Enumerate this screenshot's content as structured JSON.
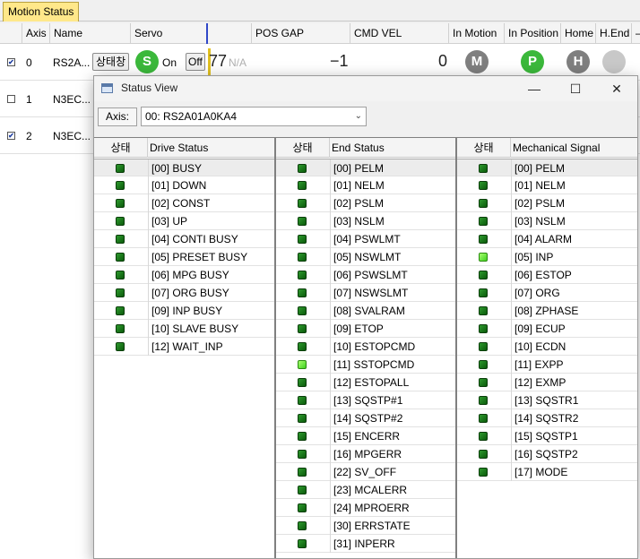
{
  "tab": {
    "label": "Motion Status"
  },
  "grid": {
    "columns": [
      "Axis",
      "Name",
      "Servo",
      "",
      "POS GAP",
      "CMD VEL",
      "In Motion",
      "In Position",
      "Home",
      "H.End",
      "–"
    ],
    "rows": [
      {
        "axis": "0",
        "name": "RS2A...",
        "checked": true
      },
      {
        "axis": "1",
        "name": "N3EC...",
        "checked": false
      },
      {
        "axis": "2",
        "name": "N3EC...",
        "checked": true
      }
    ],
    "row0": {
      "status_button": "상태창",
      "servo_badge": "S",
      "servo_on": "On",
      "servo_off": "Off",
      "cmd_pos_partial": "77",
      "na": "N/A",
      "pos_gap": "−1",
      "cmd_vel": "0",
      "in_motion_badge": "M",
      "in_position_badge": "P",
      "home_badge": "H"
    }
  },
  "dialog": {
    "title": "Status View",
    "minimize": "—",
    "maximize": "☐",
    "close": "✕",
    "axis_label": "Axis:",
    "axis_value": "00: RS2A01A0KA4",
    "combo_arrow": "⌄",
    "panels": [
      {
        "state_header": "상태",
        "title": "Drive Status",
        "items": [
          {
            "label": "[00] BUSY",
            "on": false,
            "selected": true
          },
          {
            "label": "[01] DOWN",
            "on": false
          },
          {
            "label": "[02] CONST",
            "on": false
          },
          {
            "label": "[03] UP",
            "on": false
          },
          {
            "label": "[04] CONTI BUSY",
            "on": false
          },
          {
            "label": "[05] PRESET BUSY",
            "on": false
          },
          {
            "label": "[06] MPG BUSY",
            "on": false
          },
          {
            "label": "[07] ORG BUSY",
            "on": false
          },
          {
            "label": "[09] INP BUSY",
            "on": false
          },
          {
            "label": "[10] SLAVE BUSY",
            "on": false
          },
          {
            "label": "[12] WAIT_INP",
            "on": false
          }
        ]
      },
      {
        "state_header": "상태",
        "title": "End Status",
        "items": [
          {
            "label": "[00] PELM",
            "on": false,
            "selected": true
          },
          {
            "label": "[01] NELM",
            "on": false
          },
          {
            "label": "[02] PSLM",
            "on": false
          },
          {
            "label": "[03] NSLM",
            "on": false
          },
          {
            "label": "[04] PSWLMT",
            "on": false
          },
          {
            "label": "[05] NSWLMT",
            "on": false
          },
          {
            "label": "[06] PSWSLMT",
            "on": false
          },
          {
            "label": "[07] NSWSLMT",
            "on": false
          },
          {
            "label": "[08] SVALRAM",
            "on": false
          },
          {
            "label": "[09] ETOP",
            "on": false
          },
          {
            "label": "[10] ESTOPCMD",
            "on": false
          },
          {
            "label": "[11] SSTOPCMD",
            "on": true
          },
          {
            "label": "[12] ESTOPALL",
            "on": false
          },
          {
            "label": "[13] SQSTP#1",
            "on": false
          },
          {
            "label": "[14] SQSTP#2",
            "on": false
          },
          {
            "label": "[15] ENCERR",
            "on": false
          },
          {
            "label": "[16] MPGERR",
            "on": false
          },
          {
            "label": "[22] SV_OFF",
            "on": false
          },
          {
            "label": "[23] MCALERR",
            "on": false
          },
          {
            "label": "[24] MPROERR",
            "on": false
          },
          {
            "label": "[30] ERRSTATE",
            "on": false
          },
          {
            "label": "[31] INPERR",
            "on": false
          }
        ]
      },
      {
        "state_header": "상태",
        "title": "Mechanical Signal",
        "items": [
          {
            "label": "[00] PELM",
            "on": false,
            "selected": true
          },
          {
            "label": "[01] NELM",
            "on": false
          },
          {
            "label": "[02] PSLM",
            "on": false
          },
          {
            "label": "[03] NSLM",
            "on": false
          },
          {
            "label": "[04] ALARM",
            "on": false
          },
          {
            "label": "[05] INP",
            "on": true
          },
          {
            "label": "[06] ESTOP",
            "on": false
          },
          {
            "label": "[07] ORG",
            "on": false
          },
          {
            "label": "[08] ZPHASE",
            "on": false
          },
          {
            "label": "[09] ECUP",
            "on": false
          },
          {
            "label": "[10] ECDN",
            "on": false
          },
          {
            "label": "[11] EXPP",
            "on": false
          },
          {
            "label": "[12] EXMP",
            "on": false
          },
          {
            "label": "[13] SQSTR1",
            "on": false
          },
          {
            "label": "[14] SQSTR2",
            "on": false
          },
          {
            "label": "[15] SQSTP1",
            "on": false
          },
          {
            "label": "[16] SQSTP2",
            "on": false
          },
          {
            "label": "[17] MODE",
            "on": false
          }
        ]
      }
    ]
  },
  "colors": {
    "servo_badge": "#3bb83b",
    "in_position_badge": "#3bb83b",
    "inactive_badge": "#7f7f7f",
    "led_off": "#1e7a1e",
    "led_on": "#66e830",
    "tab_bg": "#ffe88a"
  }
}
